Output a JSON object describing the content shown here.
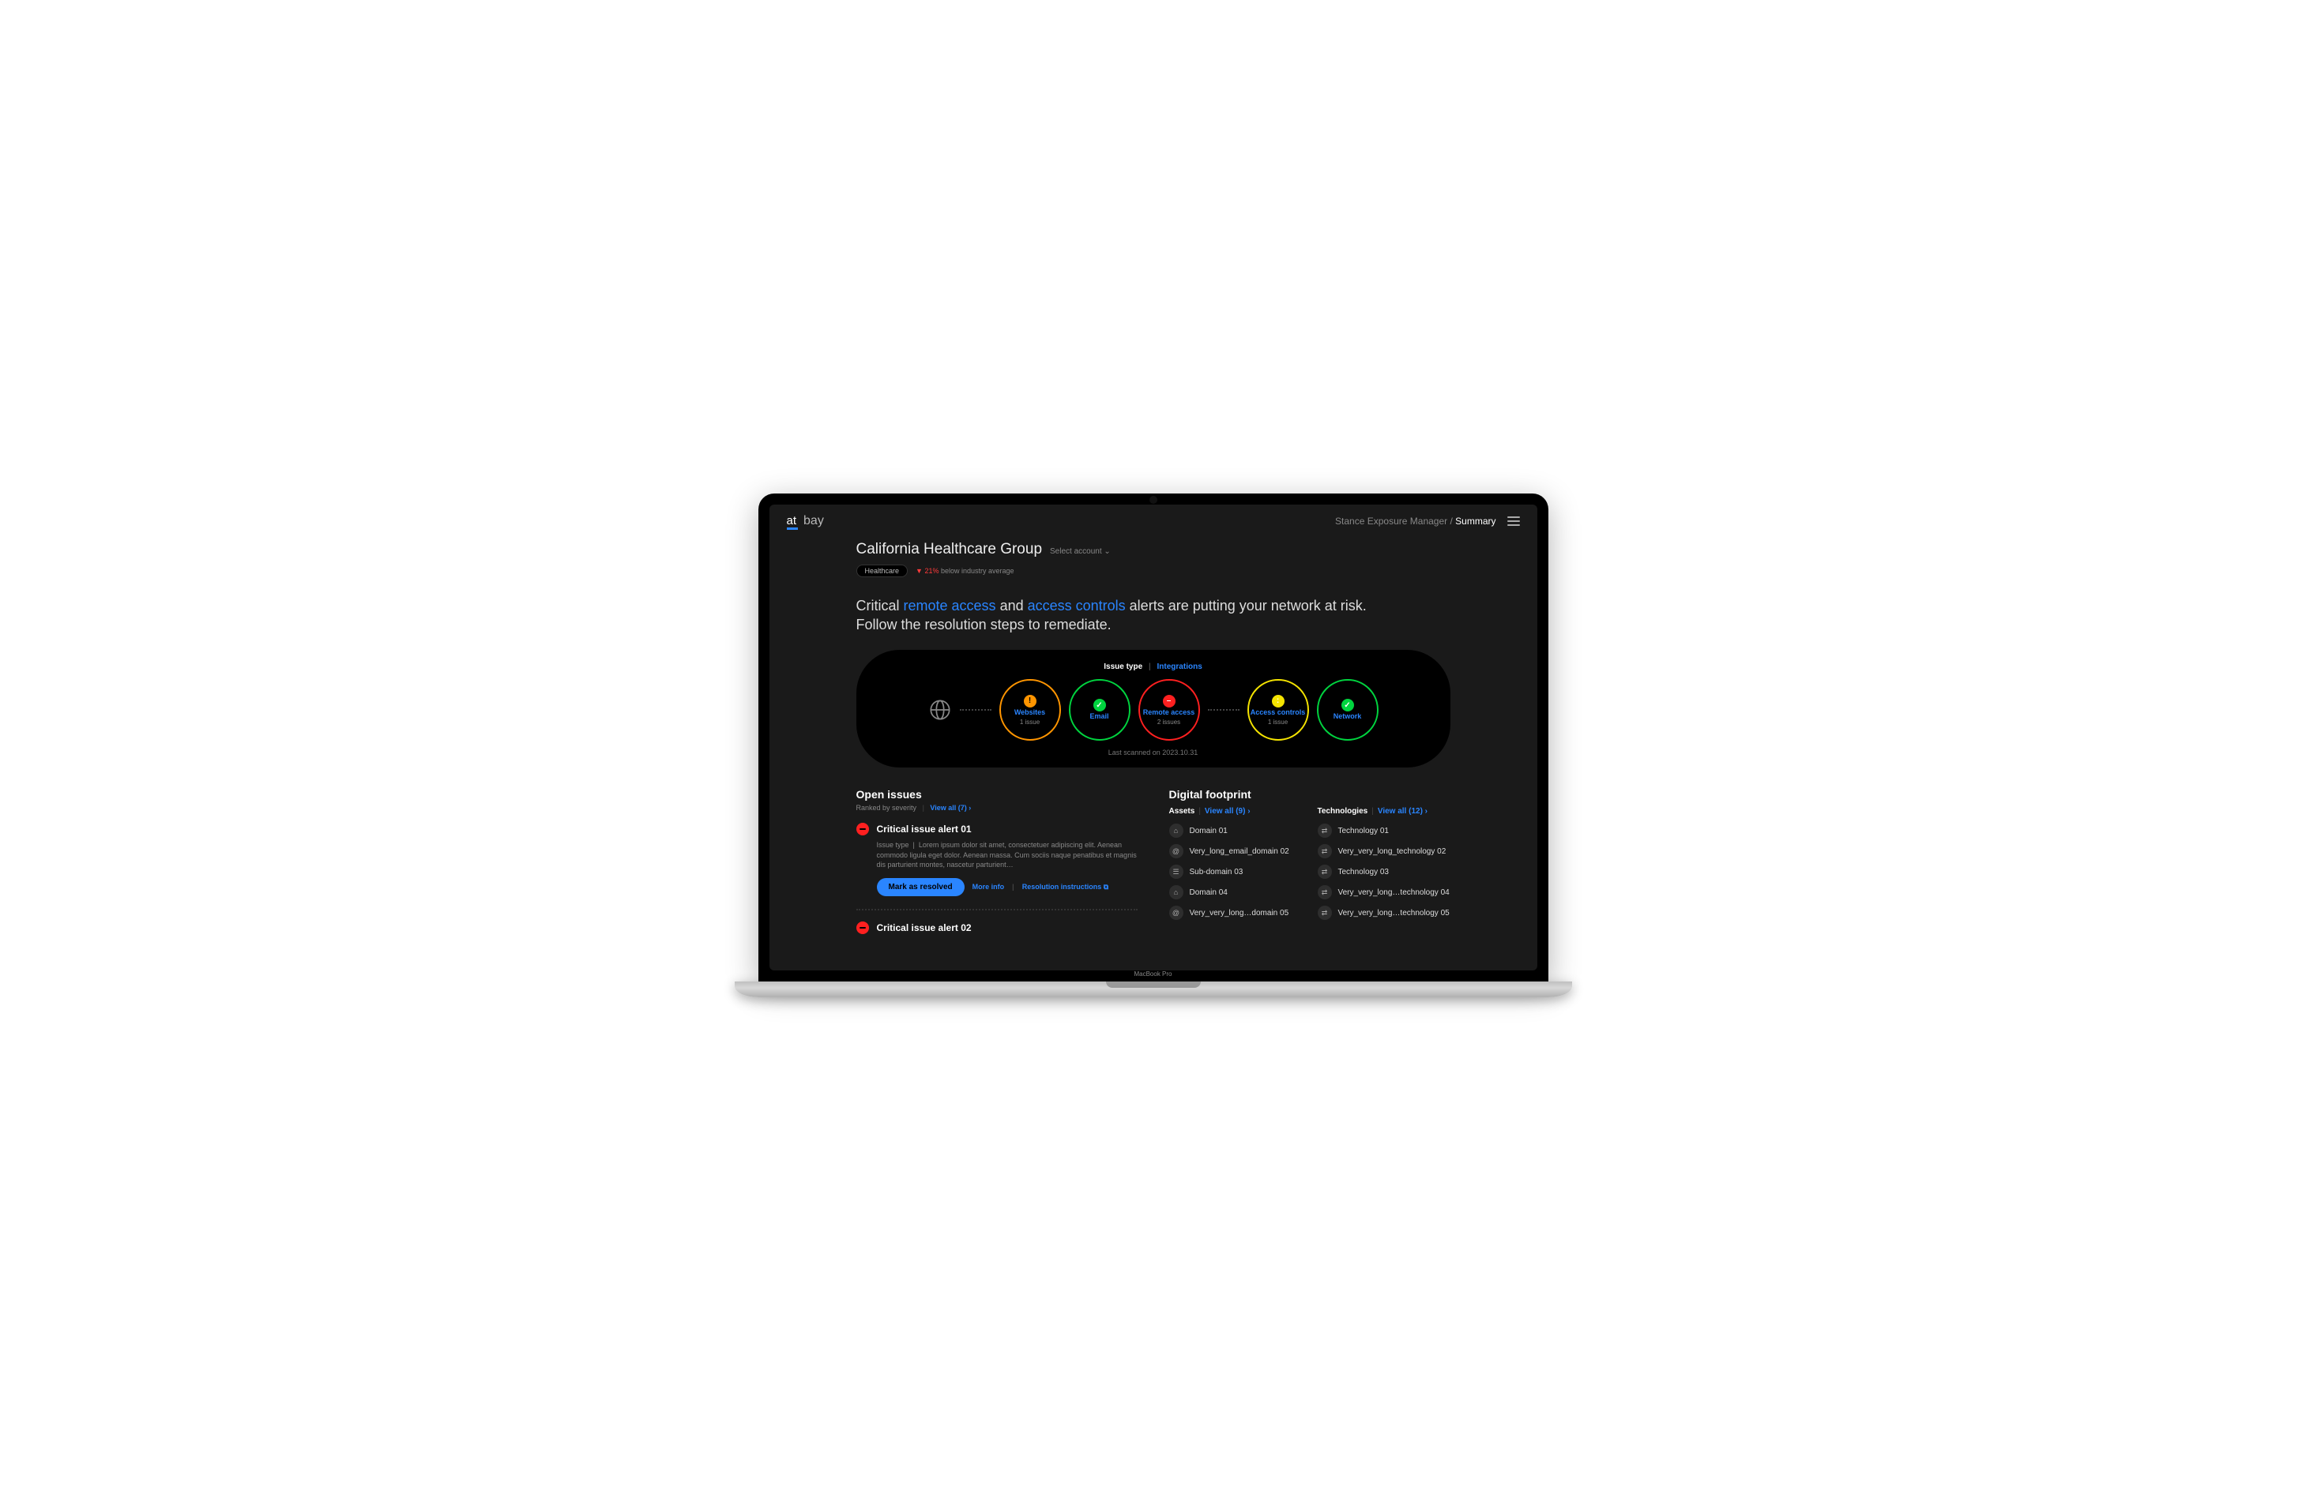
{
  "header": {
    "logo_at": "at",
    "logo_bay": "bay",
    "breadcrumb_parent": "Stance Exposure Manager",
    "breadcrumb_current": "Summary"
  },
  "account": {
    "title": "California Healthcare Group",
    "select_label": "Select account",
    "industry": "Healthcare",
    "delta_pct": "21%",
    "delta_text": "below industry average"
  },
  "headline": {
    "pre": "Critical ",
    "link1": "remote access",
    "mid": " and ",
    "link2": "access controls",
    "post": " alerts are putting your network at risk. Follow the resolution steps to remediate."
  },
  "circles": {
    "tab_a": "Issue type",
    "tab_b": "Integrations",
    "nodes": [
      {
        "color": "orange",
        "icon": "!",
        "label": "Websites",
        "sub": "1 issue"
      },
      {
        "color": "green",
        "icon": "✓",
        "label": "Email",
        "sub": ""
      },
      {
        "color": "red",
        "icon": "–",
        "label": "Remote access",
        "sub": "2 issues"
      },
      {
        "color": "yellow",
        "icon": ":",
        "label": "Access controls",
        "sub": "1 issue"
      },
      {
        "color": "green",
        "icon": "✓",
        "label": "Network",
        "sub": ""
      }
    ],
    "last_scan": "Last scanned on 2023.10.31"
  },
  "open_issues": {
    "title": "Open issues",
    "sub": "Ranked by severity",
    "view_all": "View all (7)",
    "issue1": {
      "title": "Critical issue alert 01",
      "type_label": "Issue type",
      "desc": "Lorem ipsum dolor sit amet, consectetuer adipiscing elit. Aenean commodo ligula eget dolor. Aenean massa. Cum sociis naque penatibus et magnis dis parturient montes, nascetur parturient…",
      "resolve": "Mark as resolved",
      "more": "More info",
      "instructions": "Resolution instructions"
    },
    "issue2": {
      "title": "Critical issue alert 02"
    }
  },
  "footprint": {
    "title": "Digital footprint",
    "assets_label": "Assets",
    "assets_view_all": "View all (9)",
    "tech_label": "Technologies",
    "tech_view_all": "View all (12)",
    "assets": [
      {
        "icon": "⌂",
        "name": "Domain 01"
      },
      {
        "icon": "@",
        "name": "Very_long_email_domain 02"
      },
      {
        "icon": "☰",
        "name": "Sub-domain 03"
      },
      {
        "icon": "⌂",
        "name": "Domain 04"
      },
      {
        "icon": "@",
        "name": "Very_very_long…domain 05"
      }
    ],
    "technologies": [
      {
        "icon": "⇄",
        "name": "Technology 01"
      },
      {
        "icon": "⇄",
        "name": "Very_very_long_technology 02"
      },
      {
        "icon": "⇄",
        "name": "Technology 03"
      },
      {
        "icon": "⇄",
        "name": "Very_very_long…technology 04"
      },
      {
        "icon": "⇄",
        "name": "Very_very_long…technology 05"
      }
    ]
  },
  "device": "MacBook Pro"
}
